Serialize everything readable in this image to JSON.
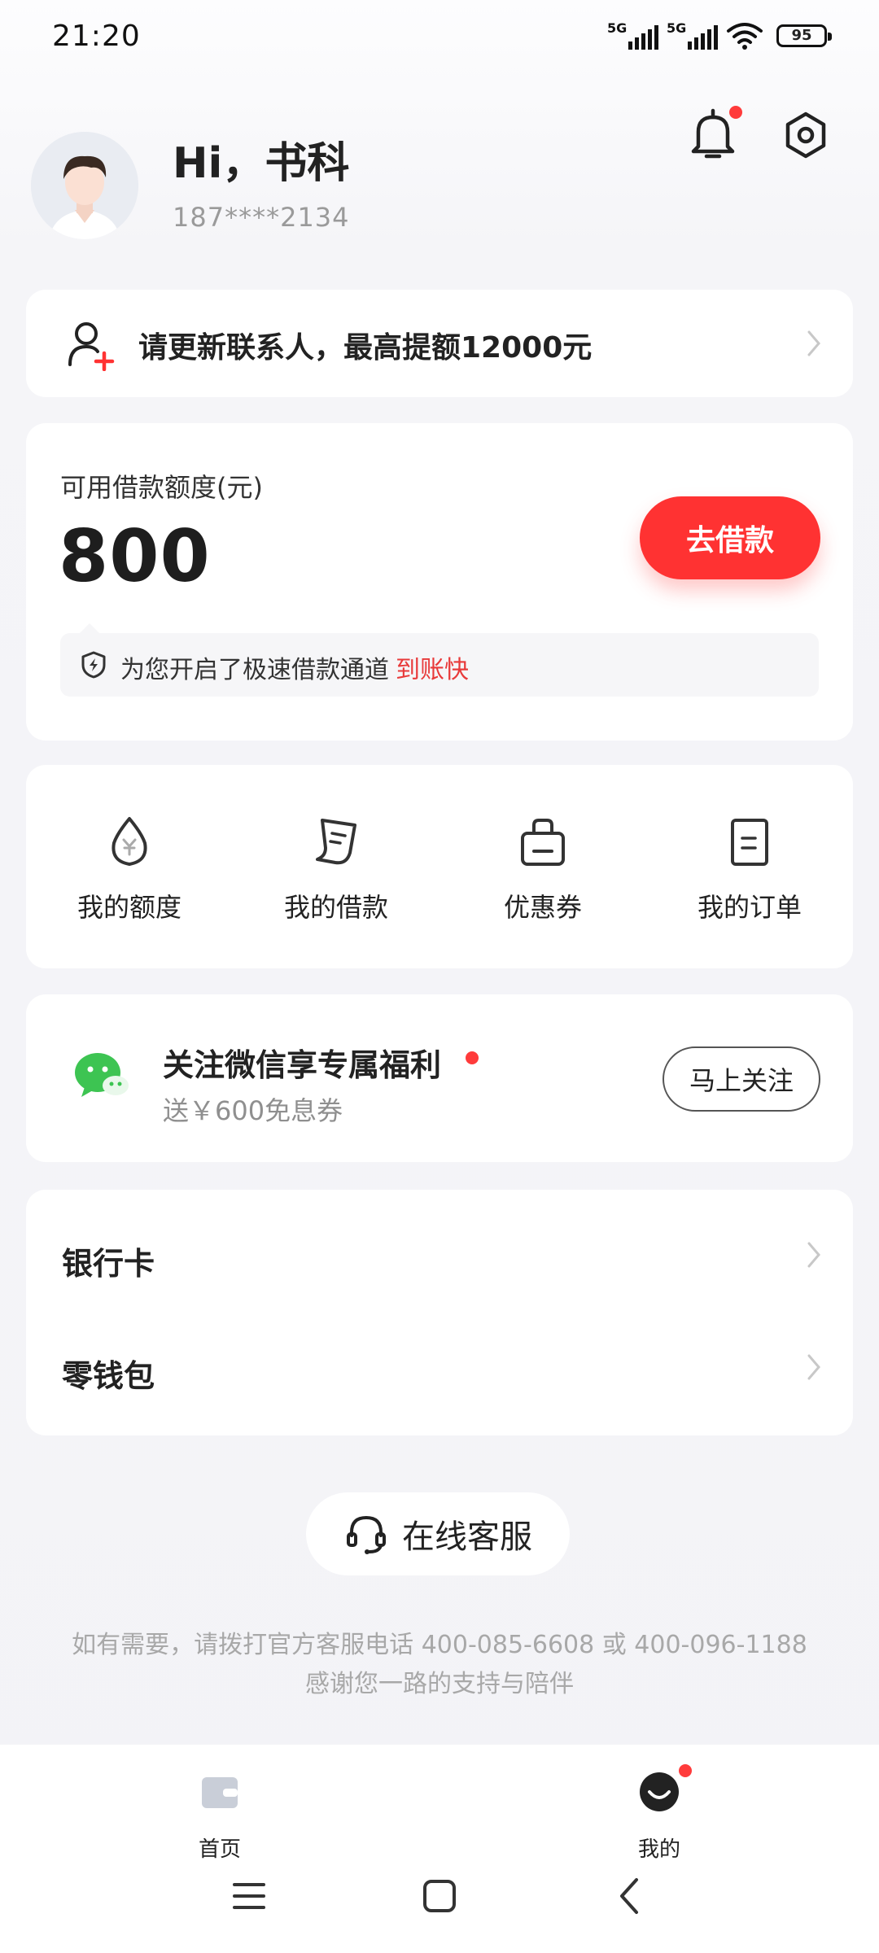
{
  "status_bar": {
    "time": "21:20",
    "signal1_label": "5G",
    "signal2_label": "5G",
    "battery": "95"
  },
  "profile": {
    "greeting": "Hi，书科",
    "phone": "187****2134"
  },
  "contact_banner": {
    "text": "请更新联系人，最高提额12000元"
  },
  "credit": {
    "label": "可用借款额度(元)",
    "amount": "800",
    "borrow_button": "去借款",
    "tip_text": "为您开启了极速借款通道",
    "tip_highlight": "到账快"
  },
  "menu": {
    "items": [
      {
        "label": "我的额度",
        "icon": "quota-drop-icon"
      },
      {
        "label": "我的借款",
        "icon": "loan-receipt-icon"
      },
      {
        "label": "优惠券",
        "icon": "coupon-bag-icon"
      },
      {
        "label": "我的订单",
        "icon": "order-document-icon"
      }
    ]
  },
  "wechat": {
    "title": "关注微信享专属福利",
    "subtitle": "送￥600免息券",
    "button": "马上关注"
  },
  "list": {
    "items": [
      {
        "label": "银行卡"
      },
      {
        "label": "零钱包"
      }
    ]
  },
  "service": {
    "label": "在线客服"
  },
  "footer": {
    "line1": "如有需要，请拨打官方客服电话 400-085-6608 或 400-096-1188",
    "line2": "感谢您一路的支持与陪伴"
  },
  "tabbar": {
    "tabs": [
      {
        "label": "首页"
      },
      {
        "label": "我的"
      }
    ]
  },
  "colors": {
    "accent": "#ff3232",
    "highlight": "#e83a3a",
    "wechat_green": "#3dc452"
  }
}
